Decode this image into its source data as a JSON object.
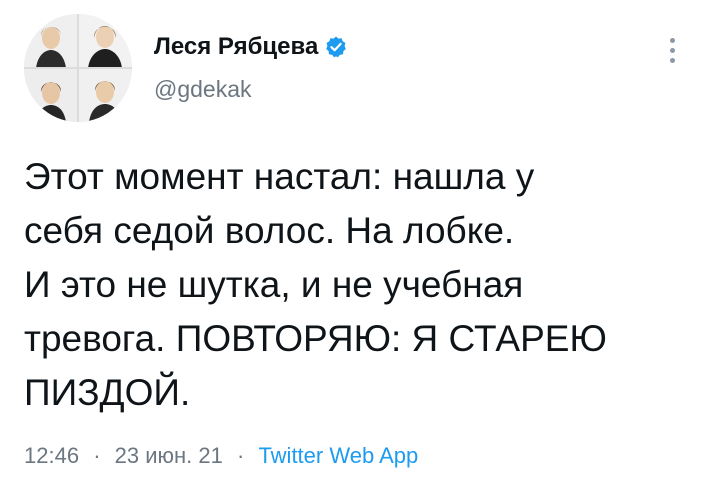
{
  "user": {
    "display_name": "Леся Рябцева",
    "handle": "@gdekak",
    "verified": true,
    "verified_color": "#1d9bf0"
  },
  "tweet": {
    "lines": [
      "Этот момент настал: нашла у",
      "себя седой волос. На лобке.",
      "И это не шутка, и не учебная",
      "тревога. ПОВТОРЯЮ: Я СТАРЕЮ",
      "ПИЗДОЙ."
    ],
    "time": "12:46",
    "separator": "·",
    "date": "23 июн. 21",
    "source": "Twitter Web App"
  },
  "icons": {
    "more": "more-vertical-icon",
    "verified": "verified-badge-icon"
  }
}
